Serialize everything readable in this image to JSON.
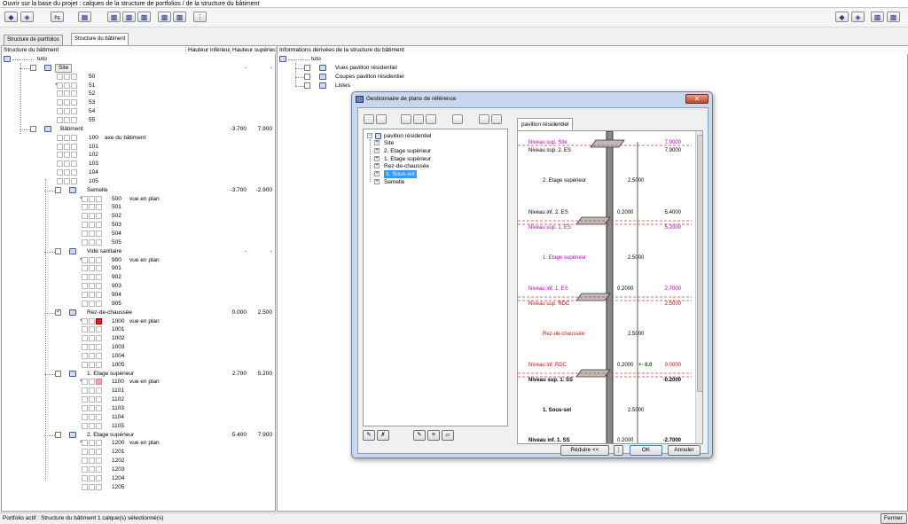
{
  "window": {
    "title": "Ouvrir sur la base du projet : calques de la structure de portfolios / de la structure du bâtiment"
  },
  "tabs": [
    {
      "label": "Structure de portfolios"
    },
    {
      "label": "Structure du bâtiment"
    }
  ],
  "left_panel": {
    "col_structure": "Structure du bâtiment",
    "col_hauteur_inf": "Hauteur inférieure",
    "col_hauteur_sup": "Hauteur supérieure"
  },
  "right_panel": {
    "header": "Informations dérivées de la structure du bâtiment",
    "root": "tuto",
    "items": [
      "Vues pavillon résidentiel",
      "Coupes pavillon résidentiel",
      "Listes"
    ]
  },
  "tree": {
    "root": "tuto",
    "site": {
      "label": "Site",
      "inf": "-",
      "sup": "-",
      "layers": [
        "50",
        "51",
        "52",
        "53",
        "54",
        "55"
      ]
    },
    "batiment": {
      "label": "Bâtiment",
      "inf": "-3.700",
      "sup": "7.900",
      "layers": [
        "100",
        "101",
        "102",
        "103",
        "104",
        "105"
      ],
      "first_desc": "axe du bâtiment"
    },
    "stories": [
      {
        "label": "Semelle",
        "inf": "-3.700",
        "sup": "-2.900",
        "desc": "vue en plan",
        "layers": [
          "500",
          "501",
          "502",
          "503",
          "504",
          "505"
        ]
      },
      {
        "label": "Vide sanitaire",
        "inf": "-",
        "sup": "-",
        "desc": "vue en plan",
        "layers": [
          "900",
          "901",
          "902",
          "903",
          "904",
          "905"
        ]
      },
      {
        "label": "Rez-de-chaussée",
        "inf": "0.000",
        "sup": "2.500",
        "desc": "vue en plan",
        "layers": [
          "1000",
          "1001",
          "1002",
          "1003",
          "1004",
          "1005"
        ]
      },
      {
        "label": "1. Etage supérieur",
        "inf": "2.700",
        "sup": "5.200",
        "desc": "vue en plan",
        "layers": [
          "1100",
          "1101",
          "1102",
          "1103",
          "1104",
          "1105"
        ]
      },
      {
        "label": "2. Etage supérieur",
        "inf": "5.400",
        "sup": "7.900",
        "desc": "vue en plan",
        "layers": [
          "1200",
          "1201",
          "1202",
          "1203",
          "1204",
          "1205"
        ]
      }
    ]
  },
  "dialog": {
    "title": "Gestionnaire de plans de référence",
    "tab": "pavillon résidentiel",
    "tree": {
      "root": "pavillon résidentiel",
      "items": [
        "Site",
        "2. Etage supérieur",
        "1. Etage supérieur",
        "Rez-de-chaussée",
        "1. Sous-sol",
        "Semelle"
      ],
      "selected_index": 4
    },
    "elevation": {
      "site_sup": {
        "label": "Niveau sup. Site",
        "value": "7.9000"
      },
      "es2_sup": {
        "label": "Niveau sup. 2. ES",
        "value": "7.9000"
      },
      "es2_name": "2. Etage supérieur",
      "es2_h": "2.5000",
      "es2_inf": {
        "label": "Niveau inf. 2. ES",
        "value": "5.4000",
        "gap": "0.2000"
      },
      "es1_sup": {
        "label": "Niveau sup. 1. ES",
        "value": "5.2000"
      },
      "es1_name": "1. Etage supérieur",
      "es1_h": "2.5000",
      "es1_inf": {
        "label": "Niveau inf. 1. ES",
        "value": "2.7000",
        "gap": "0.2000"
      },
      "rdc_sup": {
        "label": "Niveau sup. RDC",
        "value": "2.5000"
      },
      "rdc_name": "Rez-de-chaussée",
      "rdc_h": "2.5000",
      "rdc_inf": {
        "label": "Niveau inf. RDC",
        "value": "0.0000",
        "gap": "0.2000",
        "zero": "+- 0.0"
      },
      "ss_sup": {
        "label": "Niveau sup. 1. SS",
        "value": "-0.2000"
      },
      "ss_name": "1. Sous-sol",
      "ss_h": "2.5000",
      "ss_inf": {
        "label": "Niveau inf. 1. SS",
        "value": "-2.7000",
        "gap": "0.2000"
      }
    },
    "buttons": {
      "reduce": "Réduire <<",
      "ok": "OK",
      "cancel": "Annuler"
    }
  },
  "status": {
    "text": "Portfolio actif : Structure du bâtiment  1 calque(s) sélectionné(s)",
    "close": "Fermer"
  }
}
